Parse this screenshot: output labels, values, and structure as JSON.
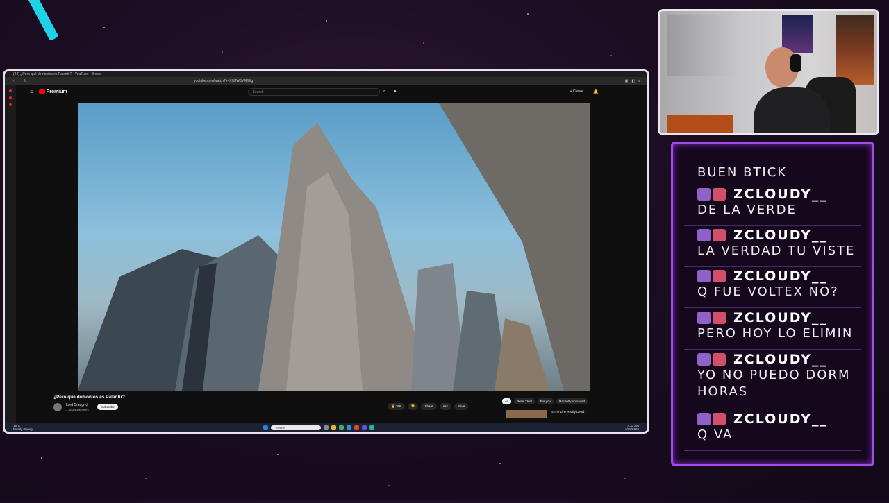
{
  "browser": {
    "tab_title": "(24) ¿Pero qué demonios es Palantir? - YouTube - Brave",
    "url": "youtube.com/watch?v=Xld8W3V48Wg"
  },
  "youtube": {
    "logo": "Premium",
    "search_placeholder": "Search",
    "create_label": "+ Create",
    "video_title": "¿Pero qué demonios es Palantir?",
    "channel_name": "Lord Draugr ⊙",
    "channel_subs": "1.38M subscribers",
    "subscribe_label": "Subscribe",
    "likes": "36K",
    "share_label": "Share",
    "ask_label": "Ask",
    "save_label": "Save",
    "chips": [
      "All",
      "Peter Thiel",
      "For you",
      "Recently uploaded"
    ],
    "recommended_title": "Is The Line Really Dead?"
  },
  "taskbar": {
    "weather_temp": "18°C",
    "weather_desc": "Mostly Cloudy",
    "search_placeholder": "Search",
    "time": "4:33 AM",
    "date": "1/18/2026"
  },
  "chat": {
    "messages": [
      {
        "user": "",
        "text": "BUEN BTICK"
      },
      {
        "user": "ZCLOUDY__",
        "text": "DE LA VERDE"
      },
      {
        "user": "ZCLOUDY__",
        "text": "LA VERDAD TU VISTE"
      },
      {
        "user": "ZCLOUDY__",
        "text": "Q FUE VOLTEX NO?"
      },
      {
        "user": "ZCLOUDY__",
        "text": "PERO HOY LO ELIMIN"
      },
      {
        "user": "ZCLOUDY__",
        "text": "YO NO PUEDO DORM",
        "text2": "HORAS"
      },
      {
        "user": "ZCLOUDY__",
        "text": "Q VA"
      }
    ]
  },
  "colors": {
    "chat_border": "#a24be6",
    "accent_cyan": "#1fd3e6",
    "youtube_red": "#ff0000"
  }
}
